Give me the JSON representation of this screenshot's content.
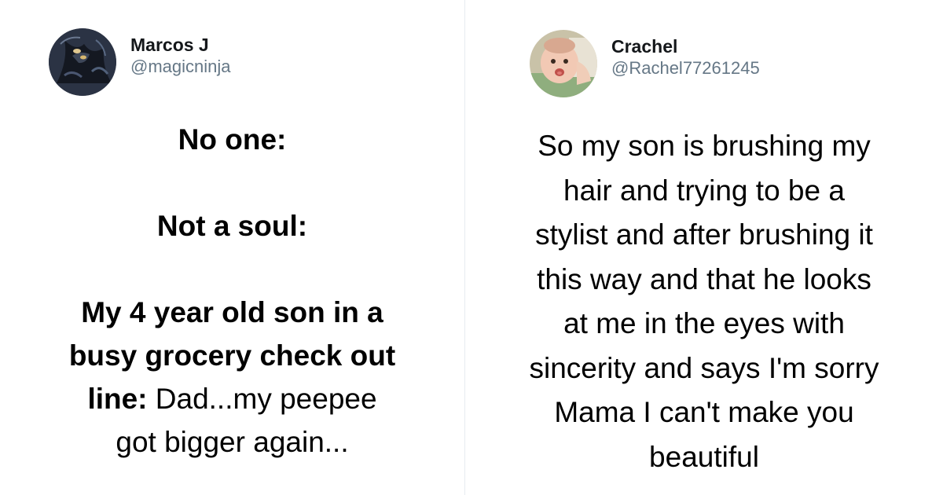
{
  "left_tweet": {
    "display_name": "Marcos J",
    "handle": "@magicninja",
    "lines": [
      {
        "bold": "No one:",
        "regular": ""
      },
      {
        "bold": "Not a soul:",
        "regular": ""
      },
      {
        "bold": "My 4 year old son in a",
        "regular": ""
      },
      {
        "bold": "busy grocery check out",
        "regular": ""
      },
      {
        "bold": "line:",
        "regular": " Dad...my peepee"
      },
      {
        "bold": "",
        "regular": "got bigger again..."
      }
    ]
  },
  "right_tweet": {
    "display_name": "Crachel",
    "handle": "@Rachel77261245",
    "lines": [
      "So my son is brushing my",
      "hair and trying to be a",
      "stylist and after brushing it",
      "this way and that he looks",
      "at me in the eyes with",
      "sincerity and says I'm sorry",
      "Mama I can't make you",
      "beautiful"
    ]
  },
  "colors": {
    "name": "#14171a",
    "handle": "#657786",
    "divider": "#e6ecf0",
    "text": "#000000"
  },
  "icons": {
    "left_avatar": "dark-fantasy-avatar-icon",
    "right_avatar": "baby-photo-avatar-icon"
  }
}
